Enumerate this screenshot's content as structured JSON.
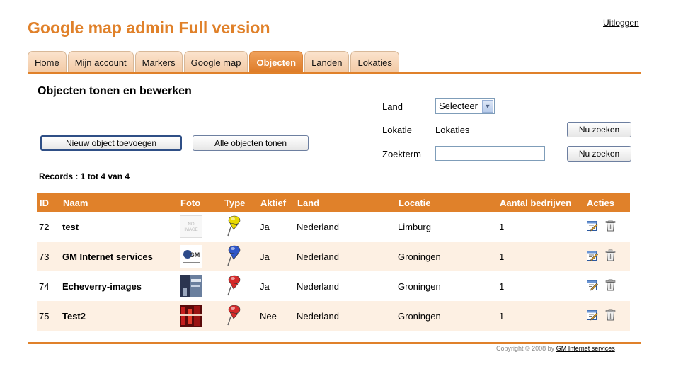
{
  "header": {
    "title": "Google map admin Full version",
    "logout": "Uitloggen"
  },
  "tabs": [
    {
      "label": "Home",
      "active": false
    },
    {
      "label": "Mijn account",
      "active": false
    },
    {
      "label": "Markers",
      "active": false
    },
    {
      "label": "Google map",
      "active": false
    },
    {
      "label": "Objecten",
      "active": true
    },
    {
      "label": "Landen",
      "active": false
    },
    {
      "label": "Lokaties",
      "active": false
    }
  ],
  "page": {
    "heading": "Objecten tonen en bewerken"
  },
  "actions": {
    "new_object": "Nieuw object toevoegen",
    "all_objects": "Alle objecten tonen"
  },
  "filters": {
    "land_label": "Land",
    "land_select_value": "Selecteer",
    "lokatie_label": "Lokatie",
    "lokatie_value": "Lokaties",
    "zoekterm_label": "Zoekterm",
    "zoekterm_value": "",
    "search_button_1": "Nu zoeken",
    "search_button_2": "Nu zoeken"
  },
  "records_text": "Records : 1 tot 4 van 4",
  "table": {
    "columns": [
      "ID",
      "Naam",
      "Foto",
      "Type",
      "Aktief",
      "Land",
      "Locatie",
      "Aantal bedrijven",
      "Acties"
    ],
    "rows": [
      {
        "id": "72",
        "name": "test",
        "foto": "no-image",
        "pin_color": "#e8d800",
        "aktief": "Ja",
        "land": "Nederland",
        "locatie": "Limburg",
        "aantal": "1"
      },
      {
        "id": "73",
        "name": "GM Internet services",
        "foto": "gm-logo",
        "pin_color": "#2f56c8",
        "aktief": "Ja",
        "land": "Nederland",
        "locatie": "Groningen",
        "aantal": "1"
      },
      {
        "id": "74",
        "name": "Echeverry-images",
        "foto": "photo-blue",
        "pin_color": "#d42a2a",
        "aktief": "Ja",
        "land": "Nederland",
        "locatie": "Groningen",
        "aantal": "1"
      },
      {
        "id": "75",
        "name": "Test2",
        "foto": "photo-red",
        "pin_color": "#d42a2a",
        "aktief": "Nee",
        "land": "Nederland",
        "locatie": "Groningen",
        "aantal": "1"
      }
    ]
  },
  "footer": {
    "copyright": "Copyright © 2008 by",
    "link": "GM Internet services"
  },
  "colors": {
    "accent": "#e0812a",
    "row_alt": "#fdf0e3"
  }
}
